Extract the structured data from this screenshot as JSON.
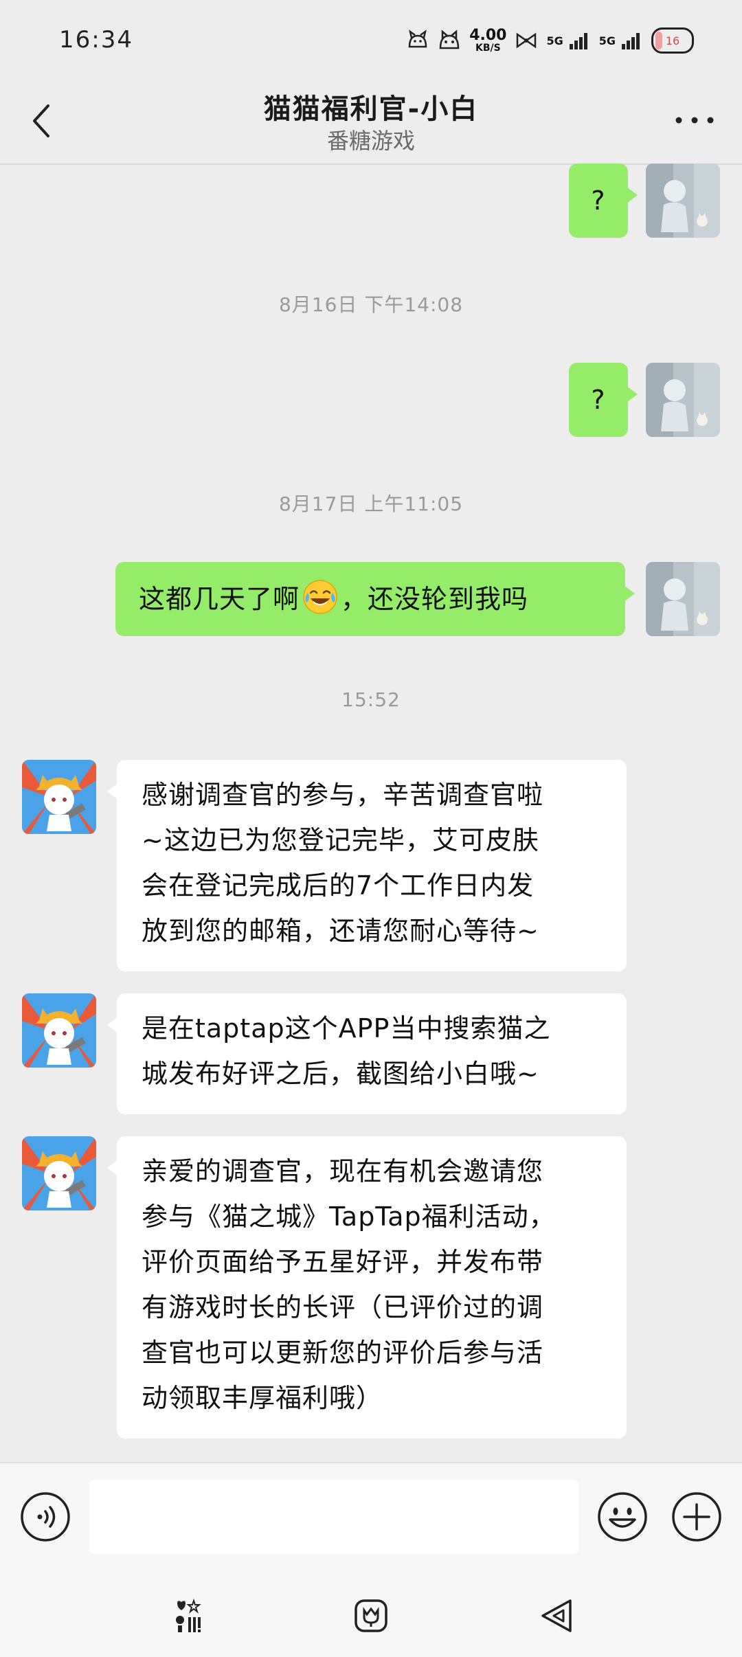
{
  "status_bar": {
    "time": "16:34",
    "net_speed_value": "4.00",
    "net_speed_unit": "KB/S",
    "sim1": "5G",
    "sim2": "5G",
    "battery": "16"
  },
  "header": {
    "title": "猫猫福利官-小白",
    "subtitle": "番糖游戏"
  },
  "messages": [
    {
      "type": "me",
      "text": "?"
    },
    {
      "type": "timestamp",
      "text": "8月16日 下午14:08"
    },
    {
      "type": "me",
      "text": "?"
    },
    {
      "type": "timestamp",
      "text": "8月17日 上午11:05"
    },
    {
      "type": "me",
      "text_before": "这都几天了啊",
      "emoji": "laughing-tears",
      "text_after": "，还没轮到我吗"
    },
    {
      "type": "timestamp",
      "text": "15:52"
    },
    {
      "type": "other",
      "lines": [
        "感谢调查官的参与，辛苦调查官啦",
        "~这边已为您登记完毕，艾可皮肤",
        "会在登记完成后的7个工作日内发",
        "放到您的邮箱，还请您耐心等待~"
      ]
    },
    {
      "type": "other",
      "lines": [
        "是在taptap这个APP当中搜索猫之",
        "城发布好评之后，截图给小白哦~"
      ]
    },
    {
      "type": "other",
      "lines": [
        "亲爱的调查官，现在有机会邀请您",
        "参与《猫之城》TapTap福利活动，",
        "评价页面给予五星好评，并发布带",
        "有游戏时长的长评（已评价过的调",
        "查官也可以更新您的评价后参与活",
        "动领取丰厚福利哦）"
      ]
    }
  ],
  "input": {
    "value": "",
    "placeholder": ""
  },
  "icons": {
    "back": "chevron-left-icon",
    "more": "more-dots-icon",
    "voice": "voice-icon",
    "emoji": "emoji-icon",
    "plus": "plus-icon"
  },
  "colors": {
    "background": "#ededed",
    "my_bubble": "#95ec69",
    "other_bubble": "#ffffff",
    "timestamp": "#9a9a9a"
  }
}
